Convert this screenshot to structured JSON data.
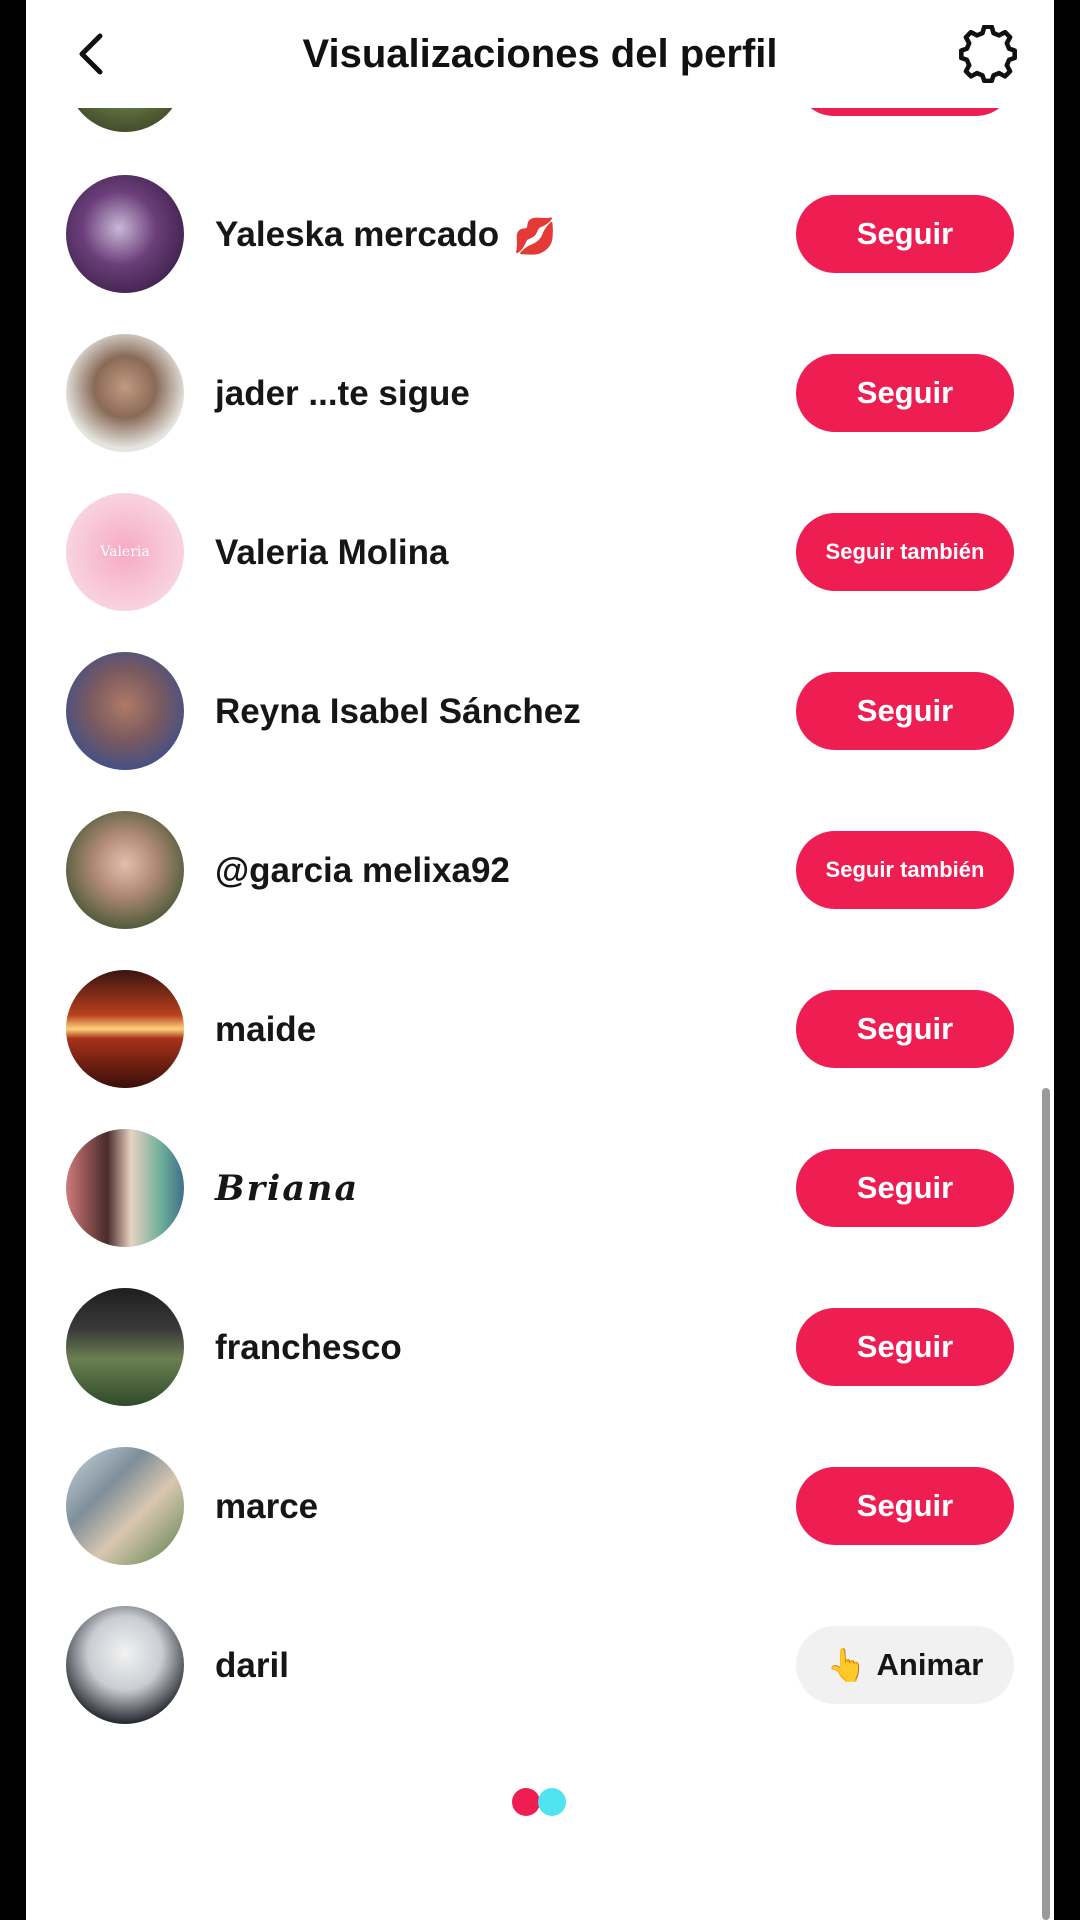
{
  "header": {
    "title": "Visualizaciones del perfil",
    "back_icon": "chevron-left-icon",
    "settings_icon": "gear-icon"
  },
  "colors": {
    "accent": "#ee1d52",
    "cheer_bg": "#f1f1f2",
    "loading_dot_1": "#ee1d52",
    "loading_dot_2": "#50e3f0"
  },
  "viewers": [
    {
      "name": "Yaleska mercado",
      "emoji": "💋",
      "action": "Seguir"
    },
    {
      "name": "jader ...te sigue",
      "action": "Seguir"
    },
    {
      "name": "Valeria Molina",
      "avatar_text": "Valeria",
      "action": "Seguir también"
    },
    {
      "name": "Reyna Isabel Sánchez",
      "action": "Seguir"
    },
    {
      "name": "@garcia melixa92",
      "action": "Seguir también"
    },
    {
      "name": "maide",
      "action": "Seguir"
    },
    {
      "name": "Briana",
      "action": "Seguir"
    },
    {
      "name": "franchesco",
      "action": "Seguir"
    },
    {
      "name": "marce",
      "action": "Seguir"
    },
    {
      "name": "daril",
      "action_icon": "👆",
      "action": "Animar"
    }
  ]
}
